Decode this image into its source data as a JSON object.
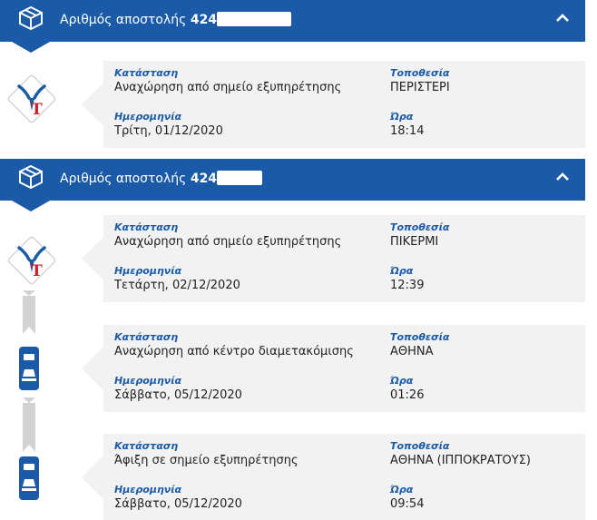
{
  "colors": {
    "primary": "#1a5aa6",
    "card_bg": "#f2f2f2",
    "connector": "#d2d2d2",
    "logo_red": "#d21e2a"
  },
  "labels": {
    "status": "Κατάσταση",
    "location": "Τοποθεσία",
    "date": "Ημερομηνία",
    "time": "Ώρα"
  },
  "shipments": [
    {
      "title_label": "Αριθμός αποστολής",
      "number_visible": "424",
      "number_redacted": true,
      "expanded": true,
      "events": [
        {
          "status": "Αναχώρηση από σημείο εξυπηρέτησης",
          "location": "ΠΕΡΙΣΤΕΡΙ",
          "date": "Τρίτη, 01/12/2020",
          "time": "18:14",
          "icon": "acs-logo-icon"
        }
      ]
    },
    {
      "title_label": "Αριθμός αποστολής",
      "number_visible": "424",
      "number_redacted": true,
      "expanded": true,
      "events": [
        {
          "status": "Αναχώρηση από σημείο εξυπηρέτησης",
          "location": "ΠΙΚΕΡΜΙ",
          "date": "Τετάρτη, 02/12/2020",
          "time": "12:39",
          "icon": "acs-logo-icon"
        },
        {
          "status": "Αναχώρηση από κέντρο διαμετακόμισης",
          "location": "ΑΘΗΝΑ",
          "date": "Σάββατο, 05/12/2020",
          "time": "01:26",
          "icon": "truck-icon"
        },
        {
          "status": "Άφιξη σε σημείο εξυπηρέτησης",
          "location": "ΑΘΗΝΑ (ΙΠΠΟΚΡΑΤΟΥΣ)",
          "date": "Σάββατο, 05/12/2020",
          "time": "09:54",
          "icon": "truck-icon"
        }
      ]
    }
  ]
}
